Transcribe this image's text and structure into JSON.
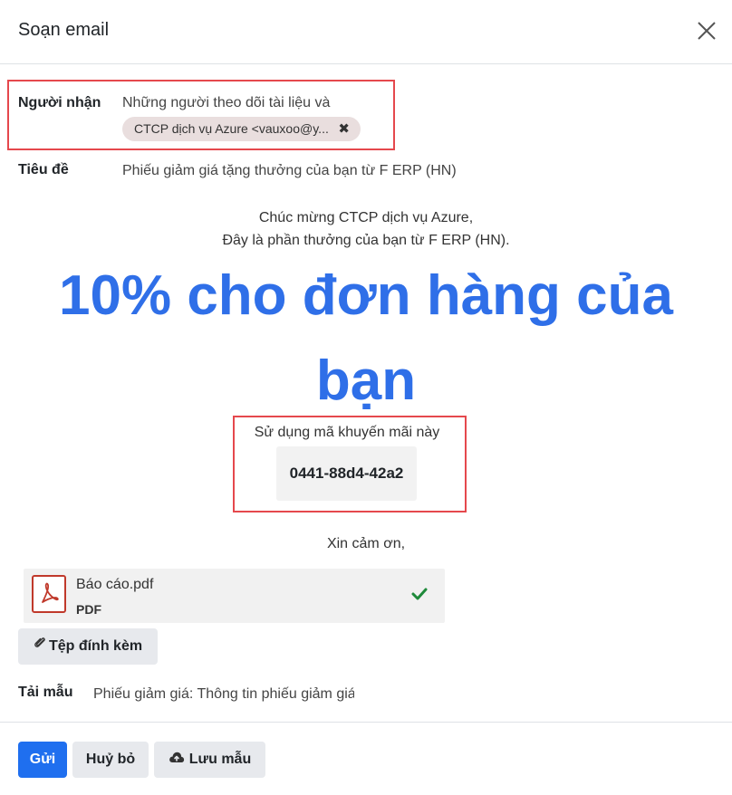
{
  "dialog": {
    "title": "Soạn email",
    "close_icon": "close-icon"
  },
  "recipients": {
    "label": "Người nhận",
    "text": "Những người theo dõi tài liệu và",
    "tag": "CTCP dịch vụ Azure <vauxoo@y...",
    "tag_remove_icon": "x-icon"
  },
  "subject": {
    "label": "Tiêu đề",
    "value": "Phiếu giảm giá tặng thưởng của bạn từ F ERP (HN)"
  },
  "body": {
    "greeting_line1": "Chúc mừng CTCP dịch vụ Azure,",
    "greeting_line2": "Đây là phần thưởng của bạn từ F ERP (HN).",
    "headline_line1": "10% cho đơn hàng của",
    "headline_line2": "bạn",
    "promo_label": "Sử dụng mã khuyến mãi này",
    "promo_code": "0441-88d4-42a2",
    "thanks": "Xin cảm ơn,"
  },
  "attachment": {
    "name": "Báo cáo.pdf",
    "type": "PDF",
    "icon": "pdf-icon",
    "status_icon": "check-icon"
  },
  "attach_button": {
    "label": "Tệp đính kèm",
    "icon": "paperclip-icon"
  },
  "template": {
    "label": "Tải mẫu",
    "value": "Phiếu giảm giá: Thông tin phiếu giảm giá"
  },
  "footer": {
    "send": "Gửi",
    "cancel": "Huỷ bỏ",
    "save_template": "Lưu mẫu",
    "save_icon": "cloud-upload-icon"
  },
  "colors": {
    "primary": "#1f6fef",
    "headline": "#2f6fe8",
    "highlight_border": "#e5484d",
    "check": "#1e8a3a",
    "pdf": "#c0392b"
  }
}
